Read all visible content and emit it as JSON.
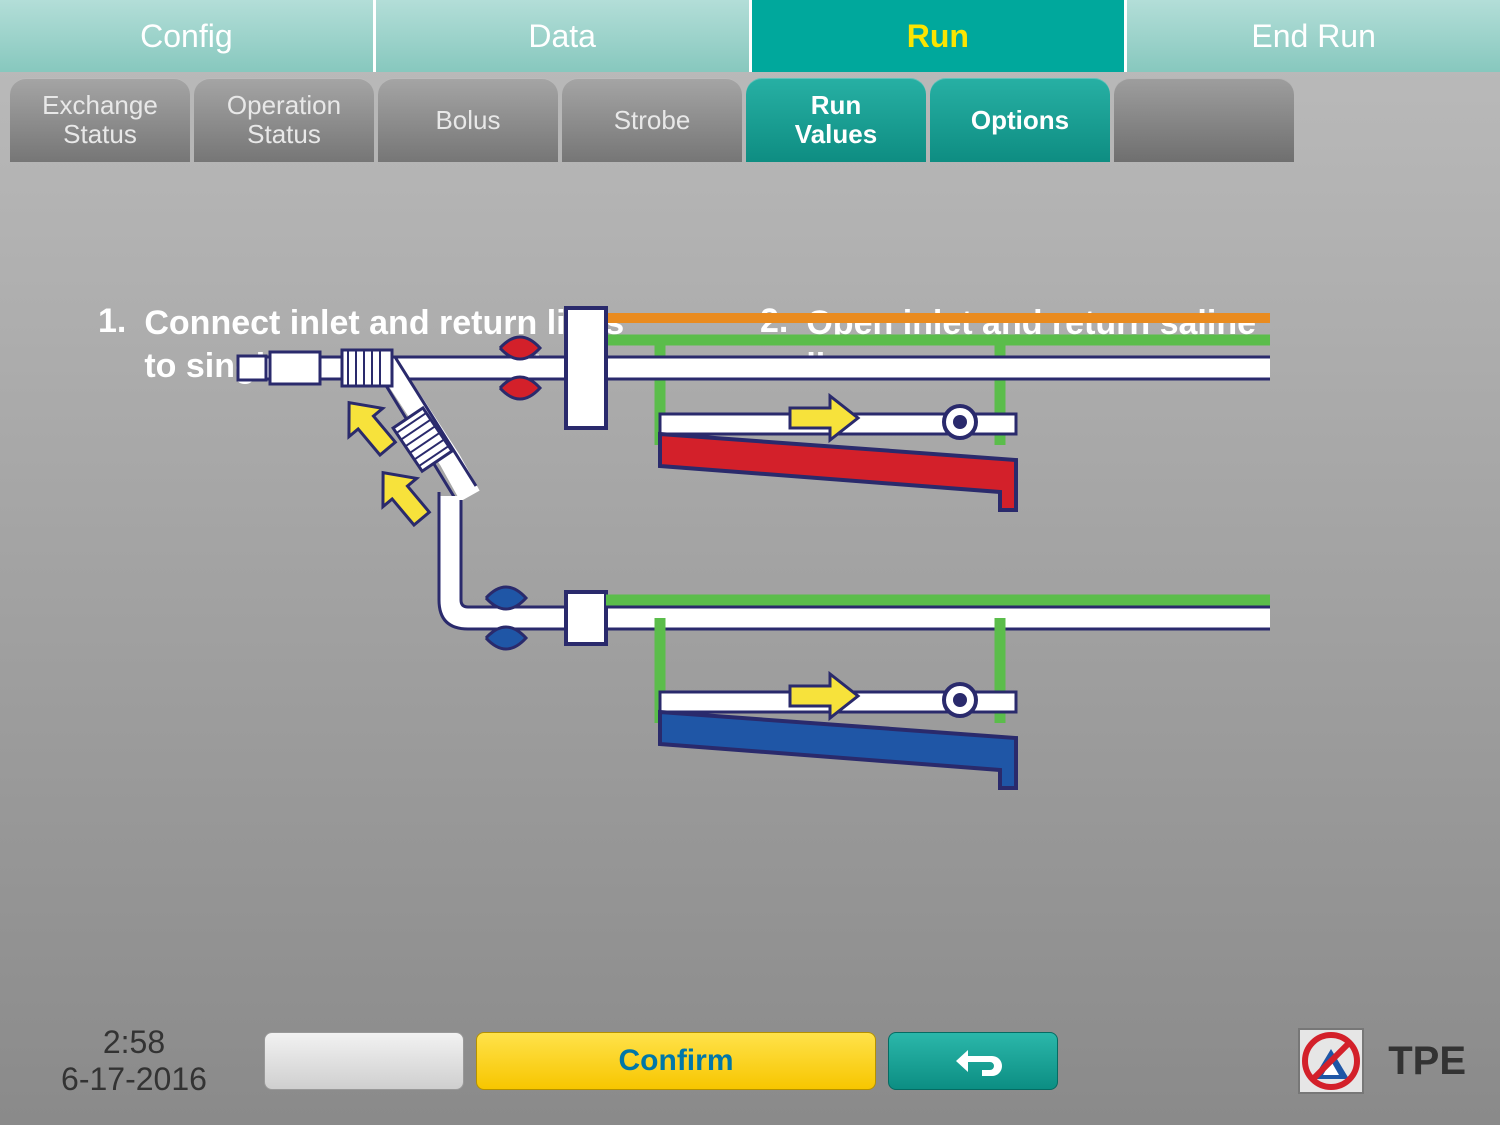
{
  "top_tabs": {
    "config": "Config",
    "data": "Data",
    "run": "Run",
    "end_run": "End Run"
  },
  "sub_tabs": {
    "exchange_status": "Exchange\nStatus",
    "operation_status": "Operation\nStatus",
    "bolus": "Bolus",
    "strobe": "Strobe",
    "run_values": "Run\nValues",
    "options": "Options"
  },
  "steps": {
    "s1_num": "1.",
    "s1_text": "Connect inlet and return lines to single-needle connector.",
    "s2_num": "2.",
    "s2_text": "Open inlet and return saline lines."
  },
  "footer": {
    "time": "2:58",
    "date": "6-17-2016",
    "confirm": "Confirm",
    "mode": "TPE"
  },
  "colors": {
    "teal": "#00a89c",
    "yellow": "#f7c600",
    "red": "#d3202a",
    "blue": "#1f56a6",
    "green": "#5bbd4b",
    "orange": "#e98b1f"
  }
}
